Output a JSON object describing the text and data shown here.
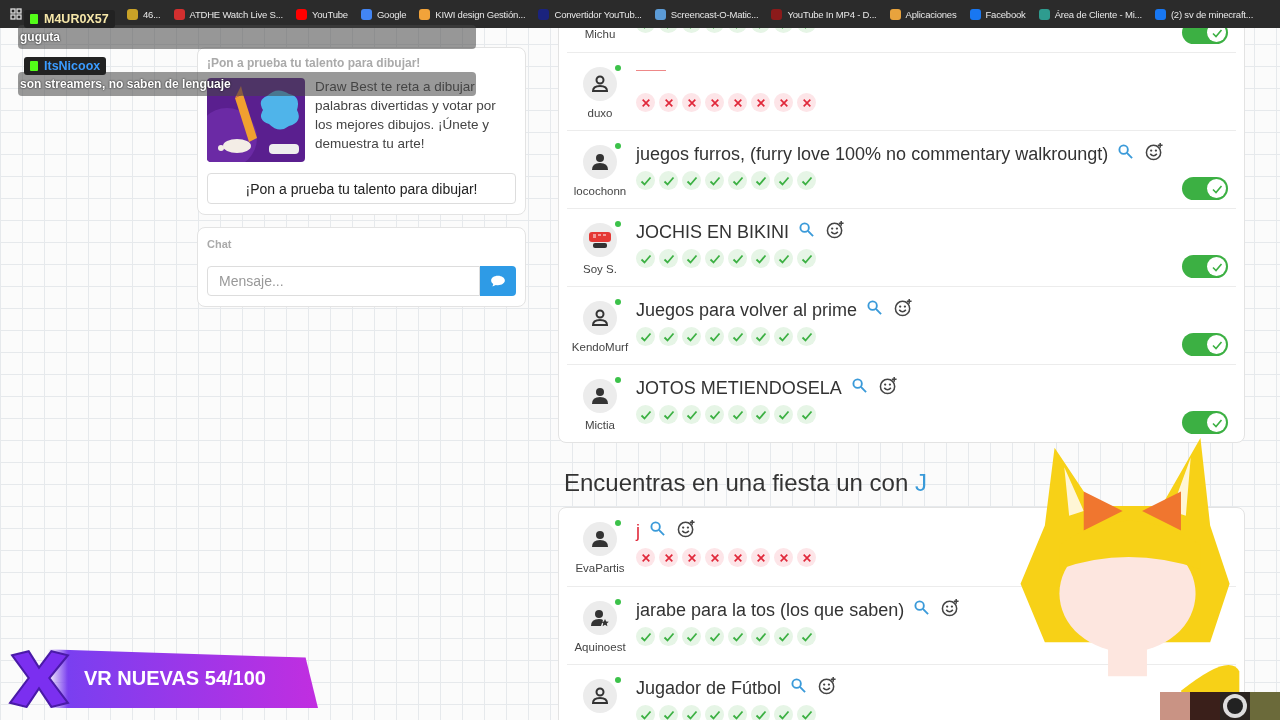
{
  "bookmarks": [
    {
      "label": "46...",
      "color": "#c9a227"
    },
    {
      "label": "ATDHE Watch Live S...",
      "color": "#d32f2f"
    },
    {
      "label": "YouTube",
      "color": "#ff0000"
    },
    {
      "label": "Google",
      "color": "#4285f4"
    },
    {
      "label": "KIWI design Gestión...",
      "color": "#f2a33a"
    },
    {
      "label": "Convertidor YouTub...",
      "color": "#1a237e"
    },
    {
      "label": "Screencast-O-Matic...",
      "color": "#5c9bd6"
    },
    {
      "label": "YouTube In MP4 - D...",
      "color": "#8b1a1a"
    },
    {
      "label": "Aplicaciones",
      "color": "#e8a33d"
    },
    {
      "label": "Facebook",
      "color": "#1877f2"
    },
    {
      "label": "Área de Cliente - Mi...",
      "color": "#2e9c8f"
    },
    {
      "label": "(2) sv de minecraft...",
      "color": "#1877f2"
    }
  ],
  "stream_chat": [
    {
      "user": "M4UR0X57",
      "color": "#f5e6a8",
      "message": "guguta"
    },
    {
      "user": "ItsNicoox",
      "color": "#3b9cff",
      "message": "son streamers, no saben de lenguaje"
    }
  ],
  "promo": {
    "title": "¡Pon a prueba tu talento para dibujar!",
    "description": "Draw Best te reta a dibujar palabras divertidas y votar por los mejores dibujos. ¡Únete y demuestra tu arte!",
    "button": "¡Pon a prueba tu talento para dibujar!"
  },
  "chat": {
    "title": "Chat",
    "placeholder": "Mensaje..."
  },
  "sections": [
    {
      "rows": [
        {
          "user": "Michu",
          "marks": [
            {
              "correct": true
            },
            {
              "correct": true
            },
            {
              "correct": true
            },
            {
              "correct": true
            },
            {
              "correct": true
            },
            {
              "correct": true
            },
            {
              "correct": true
            },
            {
              "correct": true
            }
          ],
          "toggle": {
            "on": true
          }
        },
        {
          "user": "duxo",
          "avatar": {
            "kind": "person-outline"
          },
          "online": true,
          "marks": [
            {
              "correct": false
            },
            {
              "correct": false
            },
            {
              "correct": false
            },
            {
              "correct": false
            },
            {
              "correct": false
            },
            {
              "correct": false
            },
            {
              "correct": false
            },
            {
              "correct": false
            }
          ]
        },
        {
          "user": "locochonn",
          "avatar": {
            "kind": "person"
          },
          "online": true,
          "answer": "juegos furros, (furry love 100% no commentary walkroungt)",
          "valid": true,
          "marks": [
            {
              "correct": true
            },
            {
              "correct": true
            },
            {
              "correct": true
            },
            {
              "correct": true
            },
            {
              "correct": true
            },
            {
              "correct": true
            },
            {
              "correct": true
            },
            {
              "correct": true
            }
          ],
          "toggle": {
            "on": true
          }
        },
        {
          "user": "Soy S.",
          "avatar": {
            "kind": "stop"
          },
          "online": true,
          "answer": "JOCHIS EN BIKINI",
          "valid": true,
          "marks": [
            {
              "correct": true
            },
            {
              "correct": true
            },
            {
              "correct": true
            },
            {
              "correct": true
            },
            {
              "correct": true
            },
            {
              "correct": true
            },
            {
              "correct": true
            },
            {
              "correct": true
            }
          ],
          "toggle": {
            "on": true
          }
        },
        {
          "user": "KendoMurf",
          "avatar": {
            "kind": "person-outline"
          },
          "online": true,
          "answer": "Juegos para volver al prime",
          "valid": true,
          "marks": [
            {
              "correct": true
            },
            {
              "correct": true
            },
            {
              "correct": true
            },
            {
              "correct": true
            },
            {
              "correct": true
            },
            {
              "correct": true
            },
            {
              "correct": true
            },
            {
              "correct": true
            }
          ],
          "toggle": {
            "on": true
          }
        },
        {
          "user": "Mictia",
          "avatar": {
            "kind": "person"
          },
          "online": true,
          "answer": "JOTOS METIENDOSELA",
          "valid": true,
          "marks": [
            {
              "correct": true
            },
            {
              "correct": true
            },
            {
              "correct": true
            },
            {
              "correct": true
            },
            {
              "correct": true
            },
            {
              "correct": true
            },
            {
              "correct": true
            },
            {
              "correct": true
            }
          ],
          "toggle": {
            "on": true
          }
        }
      ]
    },
    {
      "heading": "Encuentras en una fiesta un con",
      "letter": "J",
      "rows": [
        {
          "user": "EvaPartis",
          "avatar": {
            "kind": "person"
          },
          "online": true,
          "answer": "j",
          "valid": false,
          "marks": [
            {
              "correct": false
            },
            {
              "correct": false
            },
            {
              "correct": false
            },
            {
              "correct": false
            },
            {
              "correct": false
            },
            {
              "correct": false
            },
            {
              "correct": false
            },
            {
              "correct": false
            }
          ]
        },
        {
          "user": "Aquinoest",
          "avatar": {
            "kind": "person-star"
          },
          "online": true,
          "answer": "jarabe para la tos (los que saben)",
          "valid": true,
          "marks": [
            {
              "correct": true
            },
            {
              "correct": true
            },
            {
              "correct": true
            },
            {
              "correct": true
            },
            {
              "correct": true
            },
            {
              "correct": true
            },
            {
              "correct": true
            },
            {
              "correct": true
            }
          ]
        },
        {
          "avatar": {
            "kind": "person-outline"
          },
          "online": true,
          "answer": "Jugador de Fútbol",
          "valid": true,
          "marks": [
            {
              "correct": true
            },
            {
              "correct": true
            },
            {
              "correct": true
            },
            {
              "correct": true
            },
            {
              "correct": true
            },
            {
              "correct": true
            },
            {
              "correct": true
            },
            {
              "correct": true
            }
          ]
        }
      ]
    }
  ],
  "banner": {
    "text": "VR NUEVAS 54/100"
  }
}
